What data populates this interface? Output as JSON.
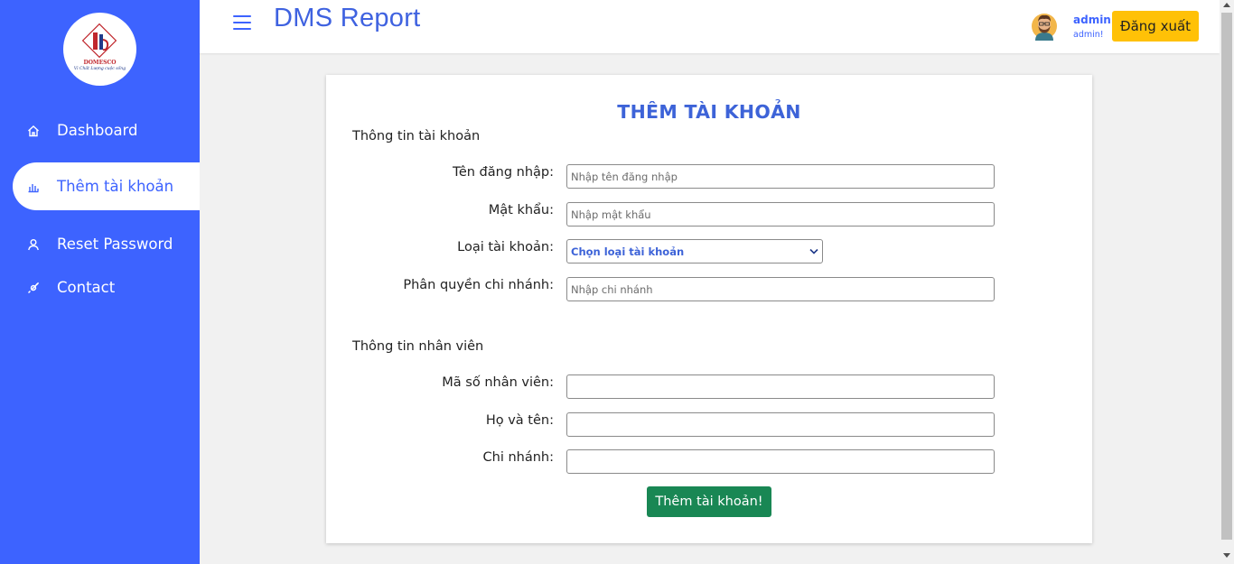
{
  "brand": {
    "logo_name": "DOMESCO",
    "logo_tagline": "Vì Chất Lượng cuộc sống"
  },
  "sidebar": {
    "items": [
      {
        "label": "Dashboard",
        "icon": "home-icon"
      },
      {
        "label": "Thêm tài khoản",
        "icon": "bar-chart-icon",
        "active": true
      },
      {
        "label": "Reset Password",
        "icon": "user-icon"
      },
      {
        "label": "Contact",
        "icon": "rocket-icon"
      }
    ]
  },
  "header": {
    "title": "DMS Report",
    "user_name": "admin",
    "user_role": "admin!",
    "logout_label": "Đăng xuất"
  },
  "form": {
    "title": "THÊM TÀI KHOẢN",
    "account_section": "Thông tin tài khoản",
    "username_label": "Tên đăng nhập:",
    "username_placeholder": "Nhập tên đăng nhập",
    "password_label": "Mật khẩu:",
    "password_placeholder": "Nhập mật khẩu",
    "account_type_label": "Loại tài khoản:",
    "account_type_value": "Chọn loại tài khoản",
    "branch_permission_label": "Phân quyền chi nhánh:",
    "branch_permission_placeholder": "Nhập chi nhánh",
    "employee_section": "Thông tin nhân viên",
    "employee_id_label": "Mã số nhân viên:",
    "employee_id_value": "",
    "full_name_label": "Họ và tên:",
    "full_name_value": "",
    "branch_label": "Chi nhánh:",
    "branch_value": "",
    "submit_label": "Thêm tài khoản!"
  },
  "colors": {
    "sidebar_bg": "#3d63ff",
    "accent": "#3d63d8",
    "logout_bg": "#ffc107",
    "submit_bg": "#198754"
  }
}
